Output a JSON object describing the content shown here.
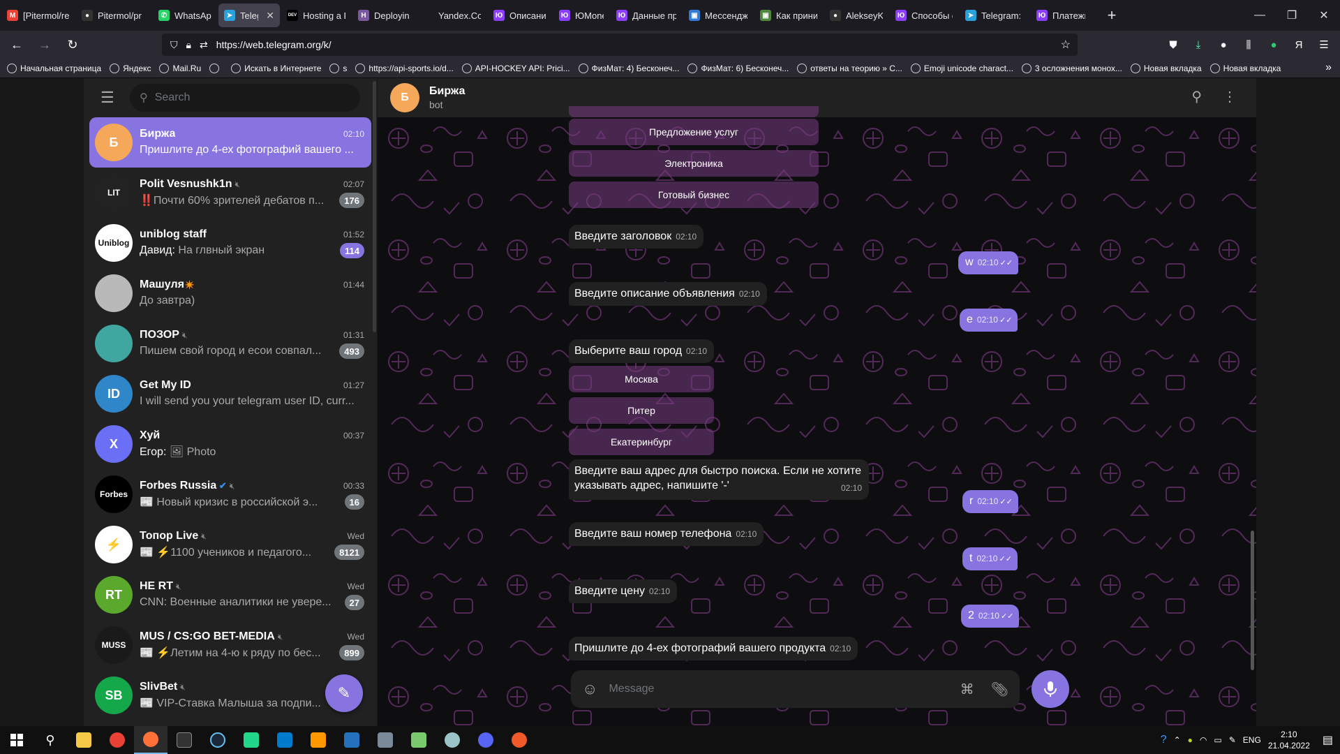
{
  "browser": {
    "tabs": [
      {
        "title": "[Pitermol/re",
        "fav_color": "#ea4335",
        "fav_char": "M"
      },
      {
        "title": "Pitermol/pr",
        "fav_color": "#333333",
        "fav_char": "●"
      },
      {
        "title": "WhatsApp",
        "fav_color": "#25d366",
        "fav_char": "✆"
      },
      {
        "title": "Telegram",
        "fav_color": "#2aa1da",
        "fav_char": "➤",
        "active": true
      },
      {
        "title": "Hosting a P",
        "fav_color": "#000000",
        "fav_char": "DEV"
      },
      {
        "title": "Deploying v",
        "fav_color": "#79589f",
        "fav_char": "H"
      },
      {
        "title": "Yandex.Code",
        "fav_color": "#1c1b22",
        "fav_char": ""
      },
      {
        "title": "Описание с",
        "fav_color": "#8b3ffd",
        "fav_char": "Ю"
      },
      {
        "title": "ЮMoney",
        "fav_color": "#8b3ffd",
        "fav_char": "Ю"
      },
      {
        "title": "Данные пр",
        "fav_color": "#8b3ffd",
        "fav_char": "Ю"
      },
      {
        "title": "Мессендж",
        "fav_color": "#2f7bd6",
        "fav_char": "▣"
      },
      {
        "title": "Как прини",
        "fav_color": "#4f8a3c",
        "fav_char": "▣"
      },
      {
        "title": "AlekseyKor",
        "fav_color": "#333333",
        "fav_char": "●"
      },
      {
        "title": "Способы о",
        "fav_color": "#8b3ffd",
        "fav_char": "Ю"
      },
      {
        "title": "Telegram: C",
        "fav_color": "#2aa1da",
        "fav_char": "➤"
      },
      {
        "title": "Платежи и",
        "fav_color": "#8b3ffd",
        "fav_char": "Ю"
      }
    ],
    "close_glyph": "✕",
    "new_tab_glyph": "+",
    "url": "https://web.telegram.org/k/",
    "bookmarks": [
      "Начальная страница",
      "Яндекс",
      "Mail.Ru",
      "",
      "Искать в Интернете",
      "s",
      "https://api-sports.io/d...",
      "API-HOCKEY API: Prici...",
      "ФизМат: 4) Бесконеч...",
      "ФизМат: 6) Бесконеч...",
      "ответы на теорию » C...",
      "Emoji unicode charact...",
      "3 осложнения монох...",
      "Новая вкладка",
      "Новая вкладка"
    ]
  },
  "sidebar": {
    "search_placeholder": "Search",
    "chats": [
      {
        "name": "Биржа",
        "time": "02:10",
        "preview": "Пришлите до 4-ех фотографий вашего ...",
        "avatar_text": "Б",
        "avatar_color": "#f5a75a",
        "active": true
      },
      {
        "name": "Polit Vesnushk1n",
        "time": "02:07",
        "preview": "‼️Почти 60% зрителей дебатов п...",
        "avatar_text": "LIT",
        "avatar_color": "#222222",
        "muted": true,
        "badge": "176"
      },
      {
        "name": "uniblog staff",
        "time": "01:52",
        "sender": "Давид:",
        "preview": "На глвный экран",
        "avatar_text": "Uniblog",
        "avatar_color": "#ffffff",
        "avatar_fg": "#111111",
        "badge": "114",
        "badge_unmuted": true
      },
      {
        "name": "Машуля",
        "name_suffix": "✴️",
        "time": "01:44",
        "preview": "До завтра)",
        "avatar_text": "",
        "avatar_color": "#b9b9b9"
      },
      {
        "name": "ПОЗОР",
        "time": "01:31",
        "preview": "Пишем свой город и есои совпал...",
        "avatar_text": "",
        "avatar_color": "#3fa6a0",
        "muted": true,
        "badge": "493"
      },
      {
        "name": "Get My ID",
        "time": "01:27",
        "preview": "I will send you your telegram user ID, curr...",
        "avatar_text": "ID",
        "avatar_color": "#2f86c9"
      },
      {
        "name": "Хуй",
        "time": "00:37",
        "sender": "Егор:",
        "preview": "🖼 Photo",
        "avatar_text": "Х",
        "avatar_color": "#6a6ff5"
      },
      {
        "name": "Forbes Russia",
        "verified": true,
        "time": "00:33",
        "preview": "📰 Новый кризис в российской э...",
        "avatar_text": "Forbes",
        "avatar_color": "#000000",
        "muted": true,
        "badge": "16"
      },
      {
        "name": "Топор Live",
        "time": "Wed",
        "preview": "📰 ⚡️1100 учеников и педагого...",
        "avatar_text": "⚡",
        "avatar_color": "#ffffff",
        "avatar_fg": "#e02020",
        "muted": true,
        "badge": "8121"
      },
      {
        "name": "НЕ RT",
        "time": "Wed",
        "preview": "CNN: Военные аналитики не увере...",
        "avatar_text": "RT",
        "avatar_color": "#5aa82c",
        "muted": true,
        "badge": "27"
      },
      {
        "name": "MUS / CS:GO BET-MEDIA",
        "time": "Wed",
        "preview": "📰 ⚡️Летим на 4-ю к ряду по бес...",
        "avatar_text": "MUSS",
        "avatar_color": "#1a1a1a",
        "muted": true,
        "badge": "899"
      },
      {
        "name": "SlivBet",
        "time": "",
        "preview": "📰 VIP-Ставка Малыша за подпи...",
        "avatar_text": "SB",
        "avatar_color": "#14a84a",
        "muted": true
      }
    ]
  },
  "chat": {
    "title": "Биржа",
    "subtitle": "bot",
    "avatar_text": "Б",
    "keyboard1": [
      "Предложение услуг",
      "Электроника",
      "Готовый бизнес"
    ],
    "keyboard2": [
      "Москва",
      "Питер",
      "Екатеринбург"
    ],
    "messages": {
      "m1": {
        "text": "Введите заголовок",
        "time": "02:10"
      },
      "o1": {
        "text": "w",
        "time": "02:10"
      },
      "m2": {
        "text": "Введите описание объявления",
        "time": "02:10"
      },
      "o2": {
        "text": "e",
        "time": "02:10"
      },
      "m3": {
        "text": "Выберите ваш город",
        "time": "02:10"
      },
      "m4_l1": {
        "text": "Введите ваш адрес для быстро поиска. Если не хотите"
      },
      "m4_l2": {
        "text": "указывать адрес, напишите '-'",
        "time": "02:10"
      },
      "o3": {
        "text": "r",
        "time": "02:10"
      },
      "m5": {
        "text": "Введите ваш номер телефона",
        "time": "02:10"
      },
      "o4": {
        "text": "t",
        "time": "02:10"
      },
      "m6": {
        "text": "Введите цену",
        "time": "02:10"
      },
      "o5": {
        "text": "2",
        "time": "02:10"
      },
      "m7": {
        "text": "Пришлите до 4-ех фотографий вашего продукта",
        "time": "02:10"
      }
    },
    "composer_placeholder": "Message",
    "accent": "#8774e1"
  },
  "taskbar": {
    "lang": "ENG",
    "time": "2:10",
    "date": "21.04.2022"
  }
}
